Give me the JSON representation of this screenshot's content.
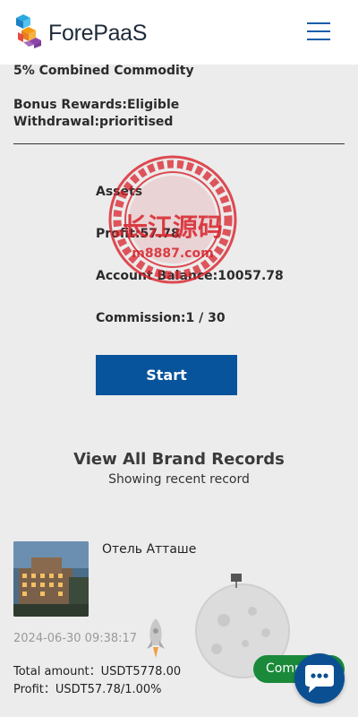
{
  "header": {
    "brand": "ForePaaS",
    "menu_icon": "hamburger-menu-icon"
  },
  "level": {
    "commodity": "5% Combined Commodity",
    "bonus": "Bonus Rewards:Eligible",
    "withdrawal": "Withdrawal:prioritised"
  },
  "assets": {
    "heading": "Assets",
    "profit": "Profit:57.78",
    "balance": "Account Balance:10057.78",
    "commission": "Commission:1 / 30"
  },
  "watermark": {
    "line1": "长江源码",
    "line2": "m8887.com"
  },
  "start_button": "Start",
  "records": {
    "title": "View All Brand Records",
    "subtitle": "Showing recent record"
  },
  "record": {
    "hotel_name": "Отель Атташе",
    "date": "2024-06-30 09:38:17",
    "total": "Total amount：USDT5778.00",
    "profit": "Profit：USDT57.78/1.00%",
    "status_button": "Commit"
  },
  "colors": {
    "primary": "#07549c",
    "commit": "#1a8a3a",
    "stamp": "#d8222a",
    "background": "#ececec"
  }
}
